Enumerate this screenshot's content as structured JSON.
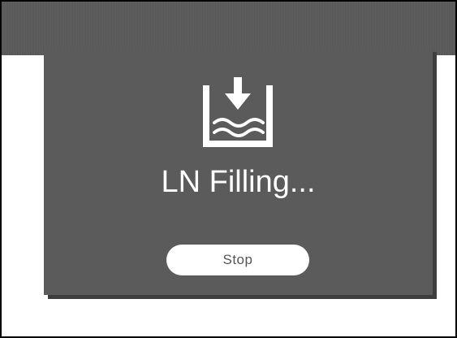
{
  "dialog": {
    "icon": "tank-fill-down-arrow-icon",
    "status_text": "LN Filling...",
    "stop_label": "Stop"
  },
  "colors": {
    "top_bar": "#5a5a5a",
    "dialog_background": "#5b5b5b",
    "dialog_shadow": "#3e3e3e",
    "text": "#ffffff",
    "button_background": "#ffffff",
    "button_text": "#555555"
  }
}
